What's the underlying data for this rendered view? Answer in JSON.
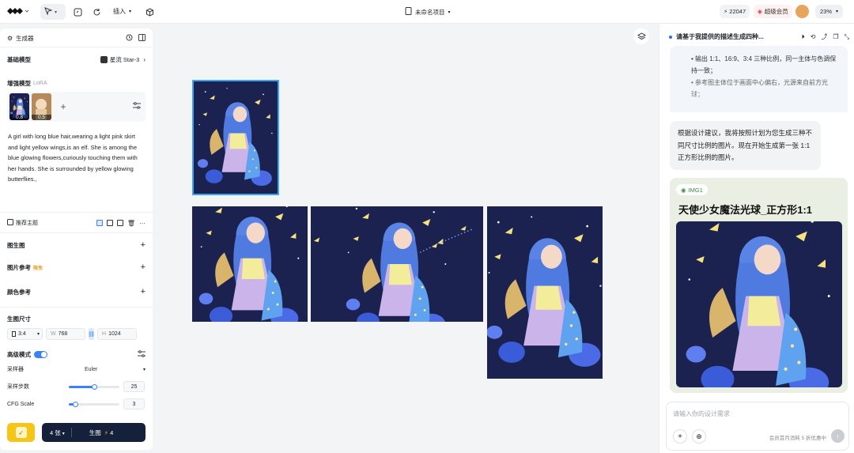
{
  "topbar": {
    "insert_label": "插入",
    "project_title": "未命名项目",
    "points": "22047",
    "vip_label": "超级会员",
    "zoom": "23%"
  },
  "generator": {
    "title": "生成器",
    "base_model_label": "基础模型",
    "base_model_value": "星流 Star-3",
    "lora_label": "增强模型",
    "lora_tag": "LoRA",
    "lora_weights": [
      "0.8",
      "0.5"
    ],
    "prompt": "A girl with long blue hair,wearing a light pink skirt and light yellow wings,is an elf. She is among the blue glowing flowers,curiously touching them with her hands. She is surrounded by yellow glowing butterflies.,",
    "recommend_label": "推荐主题",
    "img2img_label": "图生图",
    "img_ref_label": "图片参考",
    "img_ref_badge": "限免",
    "color_ref_label": "颜色参考",
    "size_label": "生图尺寸",
    "ratio": "3:4",
    "width_prefix": "W",
    "width": "768",
    "height_prefix": "H",
    "height": "1024",
    "advanced_label": "高级模式",
    "advanced_on": true,
    "sampler_label": "采样器",
    "sampler_value": "Euler",
    "steps_label": "采样步数",
    "steps_value": "25",
    "steps_fraction": 0.5,
    "cfg_label": "CFG Scale",
    "cfg_value": "3",
    "cfg_fraction": 0.12,
    "count_label": "4 张",
    "generate_label": "生图",
    "generate_cost": "4"
  },
  "chat": {
    "title": "请基于我提供的描述生成四种...",
    "bullet1": "• 输出 1:1、16:9、3:4 三种比例，同一主体与色调保持一致；",
    "bullet2": "• 参考图主体位于画面中心偏右，光源来自前方光球；",
    "reply": "根据设计建议，我将按照计划为您生成三种不同尺寸比例的图片。现在开始生成第一张 1:1 正方形比例的图片。",
    "card_tag": "IMG1",
    "card_title": "天使少女魔法光球_正方形1:1",
    "input_placeholder": "请输入你的设计需求",
    "footer_note": "会员首月消耗 5 折优惠中"
  },
  "colors": {
    "accent": "#3b82f6",
    "brand_yellow": "#f5c518",
    "dark_button": "#15203a"
  },
  "icons": [
    "logo-icon",
    "cursor-icon",
    "magic-icon",
    "refresh-icon",
    "cube-icon",
    "doc-icon",
    "lightning-icon",
    "diamond-icon",
    "avatar",
    "layers-icon",
    "eye-icon",
    "plus-icon",
    "globe-icon",
    "send-icon"
  ]
}
